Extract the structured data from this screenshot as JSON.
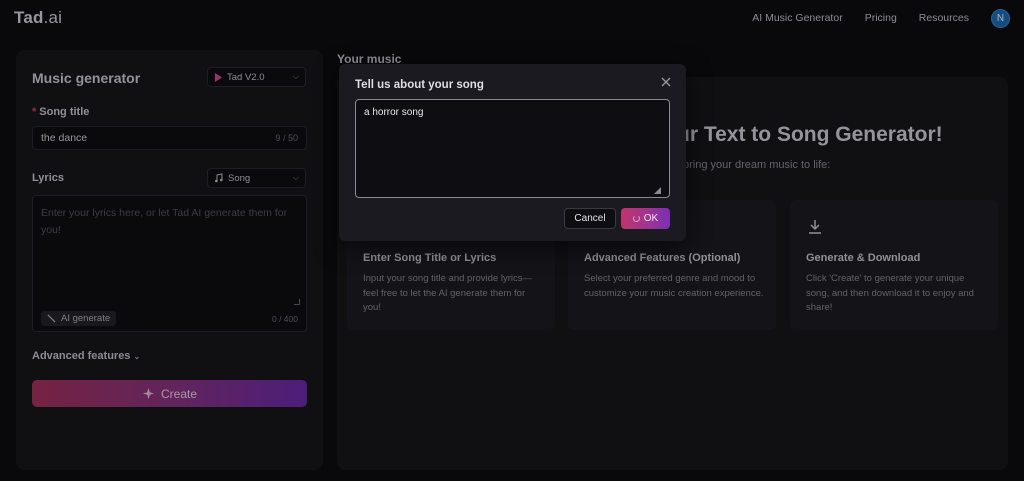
{
  "nav": {
    "logo": "Tad",
    "logo_suffix": ".ai",
    "links": [
      "AI Music Generator",
      "Pricing",
      "Resources"
    ],
    "avatar_initial": "N"
  },
  "generator": {
    "title": "Music generator",
    "model": "Tad V2.0",
    "song_title_label": "Song title",
    "song_title_value": "the dance",
    "song_title_count": "9 / 50",
    "lyrics_label": "Lyrics",
    "lyrics_mode": "Song",
    "lyrics_placeholder": "Enter your lyrics here, or let Tad AI generate them for you!",
    "ai_generate_label": "AI generate",
    "lyrics_count": "0 / 400",
    "advanced_label": "Advanced features",
    "create_label": "Create"
  },
  "music": {
    "title": "Your music",
    "hero_title": "ur Text to Song Generator!",
    "hero_sub": "bring your dream music to life:",
    "cards": [
      {
        "icon": "pencil-icon",
        "title": "Enter Song Title or Lyrics",
        "desc": "Input your song title and provide lyrics—feel free to let the AI generate them for you!"
      },
      {
        "icon": "sliders-icon",
        "title": "Advanced Features (Optional)",
        "desc": "Select your preferred genre and mood to customize your music creation experience."
      },
      {
        "icon": "download-icon",
        "title": "Generate & Download",
        "desc": "Click 'Create' to generate your unique song, and then download it to enjoy and share!"
      }
    ]
  },
  "modal": {
    "title": "Tell us about your song",
    "textarea_value": "a horror song",
    "cancel_label": "Cancel",
    "ok_label": "OK"
  },
  "colors": {
    "accent_start": "#c0356a",
    "accent_end": "#7a2fb5",
    "avatar": "#1e6fb8"
  }
}
